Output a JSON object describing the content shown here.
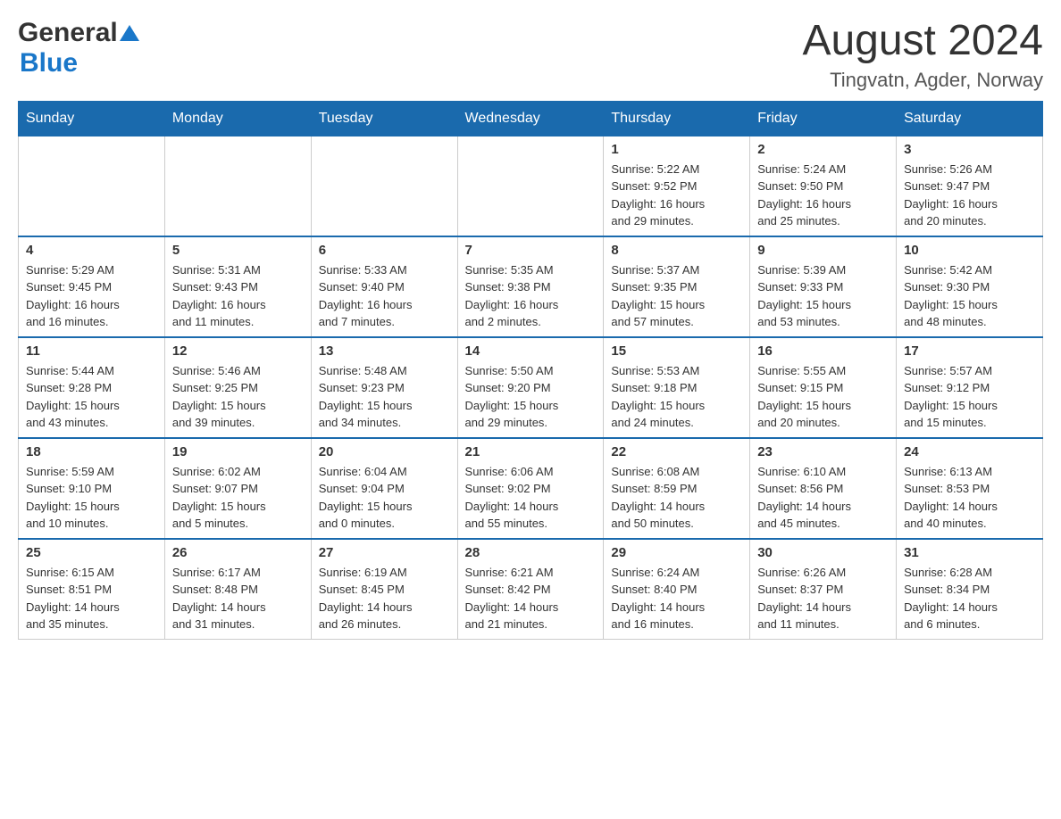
{
  "header": {
    "logo": {
      "general": "General",
      "blue": "Blue"
    },
    "title": "August 2024",
    "location": "Tingvatn, Agder, Norway"
  },
  "weekdays": [
    "Sunday",
    "Monday",
    "Tuesday",
    "Wednesday",
    "Thursday",
    "Friday",
    "Saturday"
  ],
  "weeks": [
    {
      "days": [
        {
          "number": "",
          "info": ""
        },
        {
          "number": "",
          "info": ""
        },
        {
          "number": "",
          "info": ""
        },
        {
          "number": "",
          "info": ""
        },
        {
          "number": "1",
          "info": "Sunrise: 5:22 AM\nSunset: 9:52 PM\nDaylight: 16 hours\nand 29 minutes."
        },
        {
          "number": "2",
          "info": "Sunrise: 5:24 AM\nSunset: 9:50 PM\nDaylight: 16 hours\nand 25 minutes."
        },
        {
          "number": "3",
          "info": "Sunrise: 5:26 AM\nSunset: 9:47 PM\nDaylight: 16 hours\nand 20 minutes."
        }
      ]
    },
    {
      "days": [
        {
          "number": "4",
          "info": "Sunrise: 5:29 AM\nSunset: 9:45 PM\nDaylight: 16 hours\nand 16 minutes."
        },
        {
          "number": "5",
          "info": "Sunrise: 5:31 AM\nSunset: 9:43 PM\nDaylight: 16 hours\nand 11 minutes."
        },
        {
          "number": "6",
          "info": "Sunrise: 5:33 AM\nSunset: 9:40 PM\nDaylight: 16 hours\nand 7 minutes."
        },
        {
          "number": "7",
          "info": "Sunrise: 5:35 AM\nSunset: 9:38 PM\nDaylight: 16 hours\nand 2 minutes."
        },
        {
          "number": "8",
          "info": "Sunrise: 5:37 AM\nSunset: 9:35 PM\nDaylight: 15 hours\nand 57 minutes."
        },
        {
          "number": "9",
          "info": "Sunrise: 5:39 AM\nSunset: 9:33 PM\nDaylight: 15 hours\nand 53 minutes."
        },
        {
          "number": "10",
          "info": "Sunrise: 5:42 AM\nSunset: 9:30 PM\nDaylight: 15 hours\nand 48 minutes."
        }
      ]
    },
    {
      "days": [
        {
          "number": "11",
          "info": "Sunrise: 5:44 AM\nSunset: 9:28 PM\nDaylight: 15 hours\nand 43 minutes."
        },
        {
          "number": "12",
          "info": "Sunrise: 5:46 AM\nSunset: 9:25 PM\nDaylight: 15 hours\nand 39 minutes."
        },
        {
          "number": "13",
          "info": "Sunrise: 5:48 AM\nSunset: 9:23 PM\nDaylight: 15 hours\nand 34 minutes."
        },
        {
          "number": "14",
          "info": "Sunrise: 5:50 AM\nSunset: 9:20 PM\nDaylight: 15 hours\nand 29 minutes."
        },
        {
          "number": "15",
          "info": "Sunrise: 5:53 AM\nSunset: 9:18 PM\nDaylight: 15 hours\nand 24 minutes."
        },
        {
          "number": "16",
          "info": "Sunrise: 5:55 AM\nSunset: 9:15 PM\nDaylight: 15 hours\nand 20 minutes."
        },
        {
          "number": "17",
          "info": "Sunrise: 5:57 AM\nSunset: 9:12 PM\nDaylight: 15 hours\nand 15 minutes."
        }
      ]
    },
    {
      "days": [
        {
          "number": "18",
          "info": "Sunrise: 5:59 AM\nSunset: 9:10 PM\nDaylight: 15 hours\nand 10 minutes."
        },
        {
          "number": "19",
          "info": "Sunrise: 6:02 AM\nSunset: 9:07 PM\nDaylight: 15 hours\nand 5 minutes."
        },
        {
          "number": "20",
          "info": "Sunrise: 6:04 AM\nSunset: 9:04 PM\nDaylight: 15 hours\nand 0 minutes."
        },
        {
          "number": "21",
          "info": "Sunrise: 6:06 AM\nSunset: 9:02 PM\nDaylight: 14 hours\nand 55 minutes."
        },
        {
          "number": "22",
          "info": "Sunrise: 6:08 AM\nSunset: 8:59 PM\nDaylight: 14 hours\nand 50 minutes."
        },
        {
          "number": "23",
          "info": "Sunrise: 6:10 AM\nSunset: 8:56 PM\nDaylight: 14 hours\nand 45 minutes."
        },
        {
          "number": "24",
          "info": "Sunrise: 6:13 AM\nSunset: 8:53 PM\nDaylight: 14 hours\nand 40 minutes."
        }
      ]
    },
    {
      "days": [
        {
          "number": "25",
          "info": "Sunrise: 6:15 AM\nSunset: 8:51 PM\nDaylight: 14 hours\nand 35 minutes."
        },
        {
          "number": "26",
          "info": "Sunrise: 6:17 AM\nSunset: 8:48 PM\nDaylight: 14 hours\nand 31 minutes."
        },
        {
          "number": "27",
          "info": "Sunrise: 6:19 AM\nSunset: 8:45 PM\nDaylight: 14 hours\nand 26 minutes."
        },
        {
          "number": "28",
          "info": "Sunrise: 6:21 AM\nSunset: 8:42 PM\nDaylight: 14 hours\nand 21 minutes."
        },
        {
          "number": "29",
          "info": "Sunrise: 6:24 AM\nSunset: 8:40 PM\nDaylight: 14 hours\nand 16 minutes."
        },
        {
          "number": "30",
          "info": "Sunrise: 6:26 AM\nSunset: 8:37 PM\nDaylight: 14 hours\nand 11 minutes."
        },
        {
          "number": "31",
          "info": "Sunrise: 6:28 AM\nSunset: 8:34 PM\nDaylight: 14 hours\nand 6 minutes."
        }
      ]
    }
  ]
}
